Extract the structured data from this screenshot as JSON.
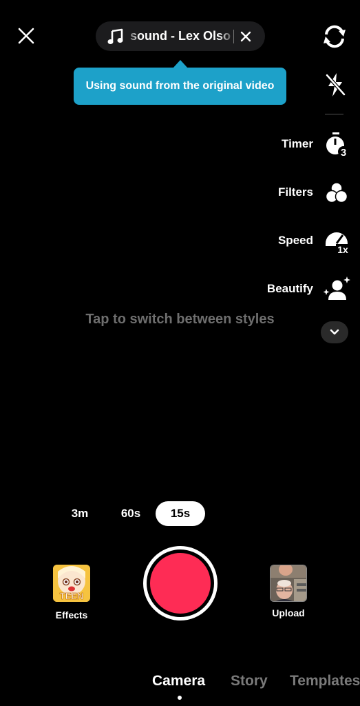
{
  "top_bar": {
    "close_icon": "close-icon",
    "sound": {
      "icon": "music-note-icon",
      "text": "sound - Lex Olson",
      "remove_icon": "close-icon"
    },
    "flip_icon": "flip-camera-icon"
  },
  "tooltip": {
    "text": "Using sound from the original video",
    "color": "#1da1c9"
  },
  "side_tools": {
    "flash_icon": "flash-off-icon",
    "items": [
      {
        "label": "Timer",
        "icon": "timer-icon",
        "badge": "3"
      },
      {
        "label": "Filters",
        "icon": "filters-icon"
      },
      {
        "label": "Speed",
        "icon": "speed-icon",
        "badge": "1x"
      },
      {
        "label": "Beautify",
        "icon": "beautify-icon"
      }
    ],
    "more_icon": "chevron-down-icon"
  },
  "hint": "Tap to switch between styles",
  "durations": {
    "options": [
      "3m",
      "60s",
      "15s"
    ],
    "selected": "15s"
  },
  "capture": {
    "record_color": "#fe2c55",
    "effects": {
      "label": "Effects",
      "thumb_text": "TEEN"
    },
    "upload": {
      "label": "Upload"
    }
  },
  "modes": {
    "items": [
      "Camera",
      "Story",
      "Templates"
    ],
    "active": "Camera"
  }
}
